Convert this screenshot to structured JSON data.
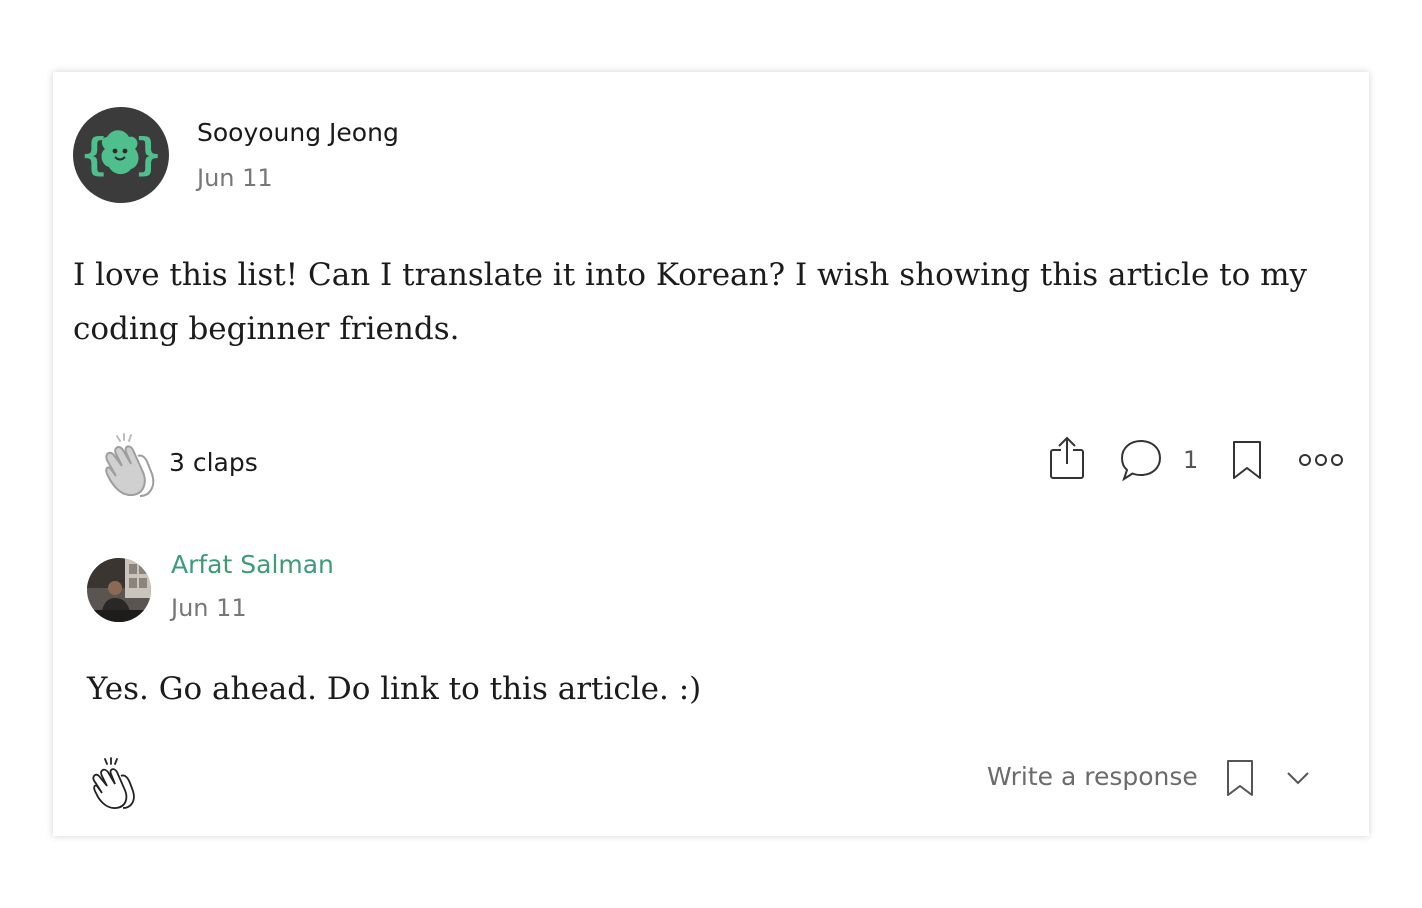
{
  "response": {
    "author": {
      "name": "Sooyoung Jeong",
      "date": "Jun 11",
      "avatar_icon": "curly-brace-blob-avatar"
    },
    "body": "I love this list! Can I translate it into Korean? I wish showing this article to my coding beginner friends.",
    "claps_label": "3 claps",
    "actions": {
      "clap_icon": "clap-icon",
      "share_icon": "share-icon",
      "responses_icon": "speech-bubble-icon",
      "responses_count": "1",
      "bookmark_icon": "bookmark-icon",
      "more_icon": "more-options-icon"
    }
  },
  "reply": {
    "author": {
      "name": "Arfat Salman",
      "date": "Jun 11",
      "avatar_icon": "user-photo-avatar"
    },
    "body": "Yes. Go ahead. Do link to this article. :)",
    "actions": {
      "clap_icon": "clap-icon",
      "write_response_label": "Write a response",
      "bookmark_icon": "bookmark-icon",
      "expand_icon": "chevron-down-icon"
    }
  },
  "colors": {
    "accent_green": "#3d9b75",
    "avatar_bg": "#3b3b3b",
    "avatar_blob": "#4fc08d",
    "text": "#1b1b1b",
    "muted": "#777777"
  }
}
